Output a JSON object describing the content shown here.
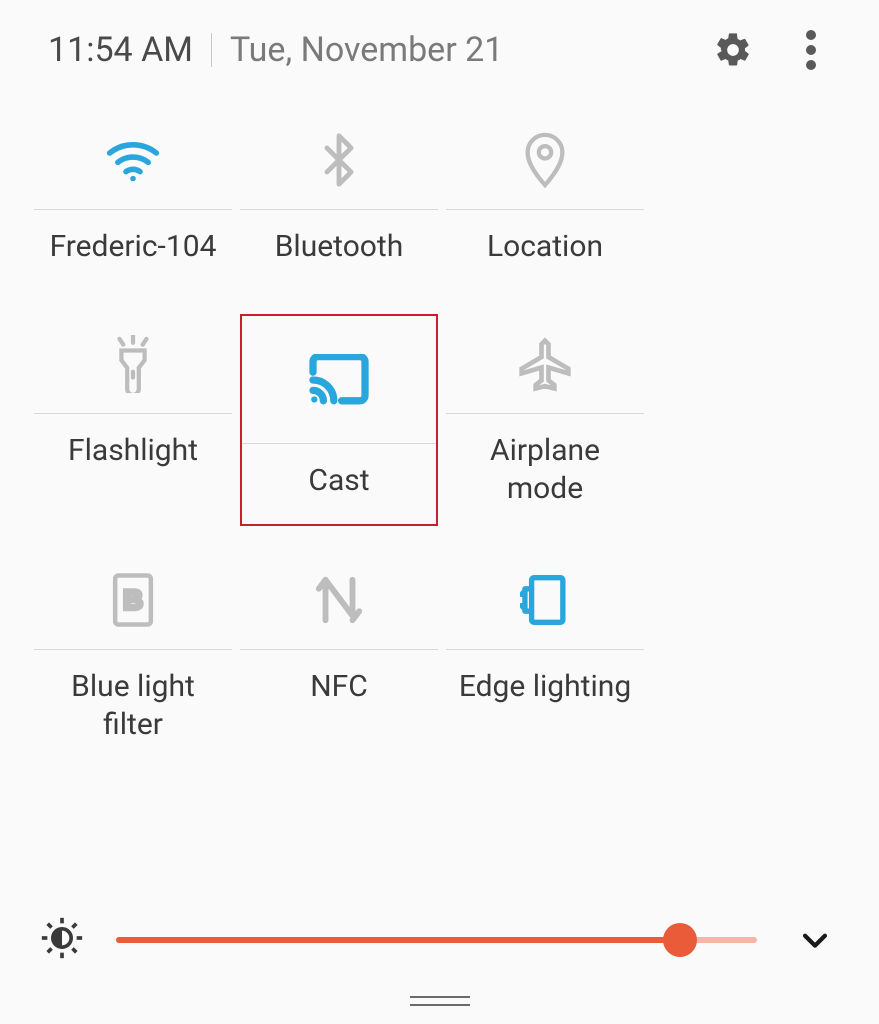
{
  "header": {
    "time": "11:54 AM",
    "date": "Tue, November 21"
  },
  "tiles": [
    {
      "label": "Frederic-104",
      "icon": "wifi",
      "active": true,
      "highlight": false
    },
    {
      "label": "Bluetooth",
      "icon": "bluetooth",
      "active": false,
      "highlight": false
    },
    {
      "label": "Location",
      "icon": "location",
      "active": false,
      "highlight": false
    },
    {
      "label": "Flashlight",
      "icon": "flashlight",
      "active": false,
      "highlight": false
    },
    {
      "label": "Cast",
      "icon": "cast",
      "active": true,
      "highlight": true
    },
    {
      "label": "Airplane mode",
      "icon": "airplane",
      "active": false,
      "highlight": false
    },
    {
      "label": "Blue light filter",
      "icon": "bluelight",
      "active": false,
      "highlight": false
    },
    {
      "label": "NFC",
      "icon": "nfc",
      "active": false,
      "highlight": false
    },
    {
      "label": "Edge lighting",
      "icon": "edgelight",
      "active": true,
      "highlight": false
    }
  ],
  "brightness": {
    "percent": 88
  },
  "colors": {
    "active": "#29a7dd",
    "inactive": "#bdbdbd",
    "accent": "#ea5b3a",
    "highlight_border": "#c81e2e"
  }
}
